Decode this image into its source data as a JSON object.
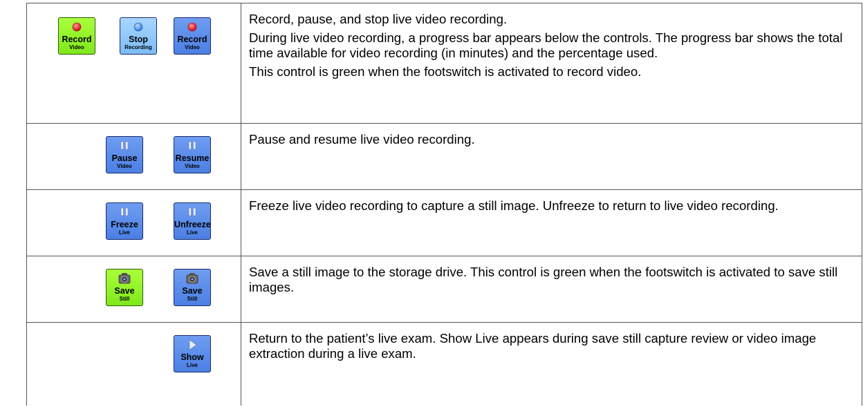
{
  "rows": [
    {
      "buttons": [
        {
          "main": "Record",
          "sub": "Video",
          "icon": "red-dot-icon",
          "color": "green"
        },
        {
          "main": "Stop",
          "sub": "Recording",
          "icon": "blue-dot-icon",
          "color": "lightblue"
        },
        {
          "main": "Record",
          "sub": "Video",
          "icon": "red-dot-icon",
          "color": "blue"
        }
      ],
      "paragraphs": [
        "Record, pause, and stop live video recording.",
        "During live video recording, a progress bar appears below the controls. The progress bar shows the total time available for video recording (in minutes) and the percentage used.",
        "This control is green when the footswitch is activated to record video."
      ]
    },
    {
      "buttons": [
        {
          "main": "Pause",
          "sub": "Video",
          "icon": "pause-icon",
          "color": "blue"
        },
        {
          "main": "Resume",
          "sub": "Video",
          "icon": "pause-icon",
          "color": "blue"
        }
      ],
      "paragraphs": [
        "Pause and resume live video recording."
      ]
    },
    {
      "buttons": [
        {
          "main": "Freeze",
          "sub": "Live",
          "icon": "pause-icon",
          "color": "blue"
        },
        {
          "main": "Unfreeze",
          "sub": "Live",
          "icon": "pause-icon",
          "color": "blue"
        }
      ],
      "paragraphs": [
        "Freeze live video recording to capture a still image. Unfreeze to return to live video recording."
      ]
    },
    {
      "buttons": [
        {
          "main": "Save",
          "sub": "Still",
          "icon": "camera-icon",
          "color": "green"
        },
        {
          "main": "Save",
          "sub": "Still",
          "icon": "camera-icon",
          "color": "blue"
        }
      ],
      "paragraphs": [
        "Save a still image to the storage drive. This control is green when the footswitch is activated to save still images."
      ]
    },
    {
      "buttons": [
        {
          "main": "Show",
          "sub": "Live",
          "icon": "play-icon",
          "color": "blue"
        }
      ],
      "paragraphs": [
        "Return to the patient’s live exam. Show Live appears during save still capture review or video image extraction during a live exam."
      ]
    }
  ],
  "colors": {
    "green": "#8cf52a",
    "blue": "#5b8cea",
    "lightblue": "#93caff",
    "record_dot": "#e8202a",
    "stop_dot": "#3a8be8"
  }
}
